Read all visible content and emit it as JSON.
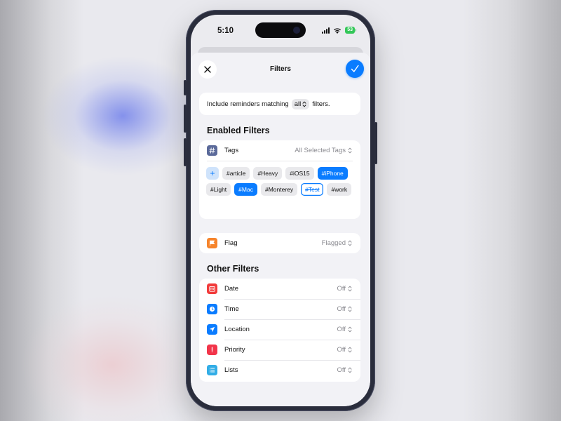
{
  "status_bar": {
    "time": "5:10",
    "battery": "53"
  },
  "nav": {
    "title": "Filters",
    "close_icon": "close-icon",
    "done_icon": "checkmark-icon"
  },
  "match": {
    "prefix": "Include reminders matching",
    "selector": "all",
    "suffix": "filters."
  },
  "enabled": {
    "heading": "Enabled Filters",
    "tags": {
      "label": "Tags",
      "value": "All Selected Tags",
      "icon": "hash-icon",
      "items": [
        {
          "text": "#article",
          "state": "normal"
        },
        {
          "text": "#Heavy",
          "state": "normal"
        },
        {
          "text": "#iOS15",
          "state": "normal"
        },
        {
          "text": "#iPhone",
          "state": "selected"
        },
        {
          "text": "#Light",
          "state": "normal"
        },
        {
          "text": "#Mac",
          "state": "selected"
        },
        {
          "text": "#Monterey",
          "state": "normal"
        },
        {
          "text": "#Test",
          "state": "excluded"
        },
        {
          "text": "#work",
          "state": "normal"
        }
      ],
      "add_symbol": "+"
    },
    "flag": {
      "label": "Flag",
      "value": "Flagged",
      "icon": "flag-icon"
    }
  },
  "other": {
    "heading": "Other Filters",
    "rows": [
      {
        "label": "Date",
        "value": "Off",
        "icon": "calendar-icon",
        "color": "#f23b3b"
      },
      {
        "label": "Time",
        "value": "Off",
        "icon": "clock-icon",
        "color": "#0a7cff"
      },
      {
        "label": "Location",
        "value": "Off",
        "icon": "location-arrow-icon",
        "color": "#0a7cff"
      },
      {
        "label": "Priority",
        "value": "Off",
        "icon": "exclamation-icon",
        "color": "#f2354a"
      },
      {
        "label": "Lists",
        "value": "Off",
        "icon": "list-icon",
        "color": "#32ade6"
      }
    ]
  },
  "colors": {
    "accent": "#0a7cff",
    "tags_icon": "#5b6a9a",
    "flag_icon": "#f6842b"
  }
}
